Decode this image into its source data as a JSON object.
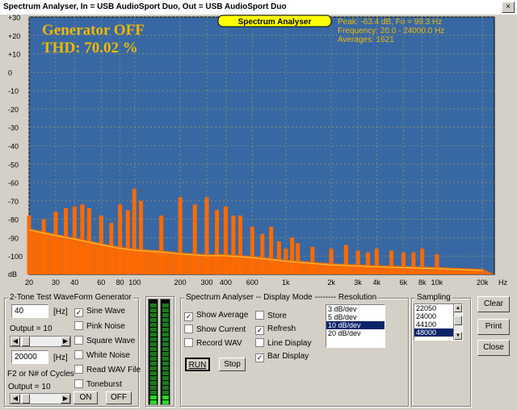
{
  "window": {
    "title": "Spectrum Analyser, In = USB AudioSport Duo, Out = USB AudioSport Duo",
    "close_glyph": "×"
  },
  "plot": {
    "badge": "Spectrum Analyser",
    "generator_status": "Generator OFF",
    "thd": "THD: 70.02 %",
    "peak": "Peak: -63.4 dB, Fo = 99.3 Hz",
    "frequency": "Frequency: 20.0 - 24000.0 Hz",
    "averages": "Averages: 1621",
    "y_unit": "dB",
    "x_unit": "Hz",
    "y_ticks": [
      "+30",
      "+20",
      "+10",
      "0",
      "-10",
      "-20",
      "-30",
      "-40",
      "-50",
      "-60",
      "-70",
      "-80",
      "-90",
      "-100"
    ],
    "x_ticks": [
      "20",
      "30",
      "40",
      "60",
      "80",
      "100",
      "200",
      "300",
      "400",
      "600",
      "1k",
      "2k",
      "3k",
      "4k",
      "6k",
      "8k",
      "10k",
      "20k"
    ],
    "colors": {
      "background": "#3868a4",
      "grid": "#b0a040",
      "trace": "#ff6a00",
      "text": "#f0b800"
    }
  },
  "chart_data": {
    "type": "bar",
    "title": "Spectrum Analyser",
    "xlabel": "Hz",
    "ylabel": "dB",
    "xscale": "log",
    "xlim": [
      20,
      24000
    ],
    "ylim": [
      -110,
      30
    ],
    "grid": true,
    "series": [
      {
        "name": "peaks",
        "x": [
          20,
          25,
          30,
          35,
          40,
          45,
          50,
          60,
          70,
          80,
          90,
          99.3,
          110,
          150,
          200,
          250,
          300,
          350,
          400,
          450,
          500,
          600,
          700,
          800,
          900,
          1000,
          1100,
          1200,
          1500,
          2000,
          2500,
          3000,
          3500,
          4000,
          5000,
          6000,
          7000,
          8000,
          10000
        ],
        "values": [
          -78,
          -80,
          -76,
          -74,
          -73,
          -72,
          -74,
          -78,
          -82,
          -72,
          -75,
          -63.4,
          -70,
          -78,
          -68,
          -72,
          -68,
          -75,
          -73,
          -78,
          -78,
          -84,
          -88,
          -84,
          -92,
          -96,
          -90,
          -93,
          -95,
          -96,
          -94,
          -97,
          -98,
          -96,
          -97,
          -98,
          -98,
          -96,
          -99
        ]
      },
      {
        "name": "average",
        "x": [
          20,
          30,
          40,
          60,
          80,
          100,
          150,
          200,
          300,
          400,
          600,
          1000,
          2000,
          4000,
          10000,
          20000
        ],
        "values": [
          -85,
          -88,
          -90,
          -93,
          -95,
          -96,
          -97,
          -98,
          -99,
          -99,
          -100,
          -102,
          -104,
          -105,
          -106,
          -107
        ]
      }
    ]
  },
  "generator": {
    "legend": "2-Tone Test WaveForm Generator",
    "freq1": "40",
    "unit1": "[Hz]",
    "output1": "Output = 10",
    "freq2": "20000",
    "unit2": "[Hz]",
    "cycles_label": "F2 or N# of Cycles",
    "output2": "Output = 10",
    "options": [
      {
        "label": "Sine Wave",
        "checked": true
      },
      {
        "label": "Pink Noise",
        "checked": false
      },
      {
        "label": "Square Wave",
        "checked": false
      },
      {
        "label": "White Noise",
        "checked": false
      },
      {
        "label": "Read WAV File",
        "checked": false
      },
      {
        "label": "Toneburst",
        "checked": false
      }
    ],
    "on_label": "ON",
    "off_label": "OFF"
  },
  "display": {
    "legend": "Spectrum Analyser -- Display Mode -------- Resolution",
    "checks": [
      {
        "label": "Show Average",
        "checked": true
      },
      {
        "label": "Show Current",
        "checked": false
      },
      {
        "label": "Record WAV",
        "checked": false
      },
      {
        "label": "Store",
        "checked": false
      },
      {
        "label": "Refresh",
        "checked": true
      },
      {
        "label": "Line Display",
        "checked": false
      },
      {
        "label": "Bar Display",
        "checked": true
      }
    ],
    "resolution": [
      "3 dB/dev",
      "5 dB/dev",
      "10 dB/dev",
      "20 dB/dev"
    ],
    "resolution_selected": "10 dB/dev",
    "run_label": "RUN",
    "stop_label": "Stop"
  },
  "sampling": {
    "legend": "Sampling",
    "rates": [
      "22050",
      "24000",
      "44100",
      "48000"
    ],
    "selected": "48000"
  },
  "buttons": {
    "clear": "Clear",
    "print": "Print",
    "close": "Close"
  },
  "meters": {
    "left_level": 0.1,
    "right_level": 0.1
  }
}
